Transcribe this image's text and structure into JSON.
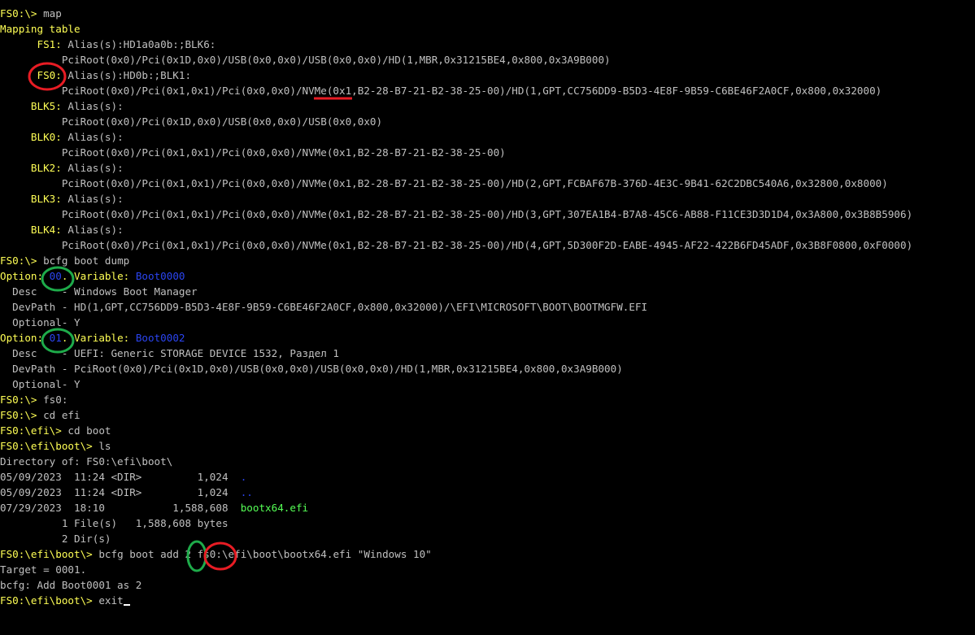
{
  "terminal": {
    "lines": [
      {
        "id": "prompt-map",
        "segments": [
          {
            "t": "FS0:\\> ",
            "c": "y"
          },
          {
            "t": "map",
            "c": "w"
          }
        ]
      },
      {
        "id": "mapping-table-heading",
        "segments": [
          {
            "t": "Mapping table",
            "c": "y"
          }
        ]
      },
      {
        "id": "map-fs1",
        "segments": [
          {
            "t": "      FS1: ",
            "c": "y"
          },
          {
            "t": "Alias(s):HD1a0a0b:;BLK6:",
            "c": "w"
          }
        ]
      },
      {
        "id": "map-fs1-path",
        "segments": [
          {
            "t": "          PciRoot(0x0)/Pci(0x1D,0x0)/USB(0x0,0x0)/USB(0x0,0x0)/HD(1,MBR,0x31215BE4,0x800,0x3A9B000)",
            "c": "w"
          }
        ]
      },
      {
        "id": "map-fs0",
        "segments": [
          {
            "t": "      FS0: ",
            "c": "y"
          },
          {
            "t": "Alias(s):HD0b:;BLK1:",
            "c": "w"
          }
        ]
      },
      {
        "id": "map-fs0-path",
        "segments": [
          {
            "t": "          PciRoot(0x0)/Pci(0x1,0x1)/Pci(0x0,0x0)/NVMe(0x1,B2-28-B7-21-B2-38-25-00)/HD(1,GPT,CC756DD9-B5D3-4E8F-9B59-C6BE46F2A0CF,0x800,0x32000)",
            "c": "w"
          }
        ]
      },
      {
        "id": "map-blk5",
        "segments": [
          {
            "t": "     BLK5: ",
            "c": "y"
          },
          {
            "t": "Alias(s):",
            "c": "w"
          }
        ]
      },
      {
        "id": "map-blk5-path",
        "segments": [
          {
            "t": "          PciRoot(0x0)/Pci(0x1D,0x0)/USB(0x0,0x0)/USB(0x0,0x0)",
            "c": "w"
          }
        ]
      },
      {
        "id": "map-blk0",
        "segments": [
          {
            "t": "     BLK0: ",
            "c": "y"
          },
          {
            "t": "Alias(s):",
            "c": "w"
          }
        ]
      },
      {
        "id": "map-blk0-path",
        "segments": [
          {
            "t": "          PciRoot(0x0)/Pci(0x1,0x1)/Pci(0x0,0x0)/NVMe(0x1,B2-28-B7-21-B2-38-25-00)",
            "c": "w"
          }
        ]
      },
      {
        "id": "map-blk2",
        "segments": [
          {
            "t": "     BLK2: ",
            "c": "y"
          },
          {
            "t": "Alias(s):",
            "c": "w"
          }
        ]
      },
      {
        "id": "map-blk2-path",
        "segments": [
          {
            "t": "          PciRoot(0x0)/Pci(0x1,0x1)/Pci(0x0,0x0)/NVMe(0x1,B2-28-B7-21-B2-38-25-00)/HD(2,GPT,FCBAF67B-376D-4E3C-9B41-62C2DBC540A6,0x32800,0x8000)",
            "c": "w"
          }
        ]
      },
      {
        "id": "map-blk3",
        "segments": [
          {
            "t": "     BLK3: ",
            "c": "y"
          },
          {
            "t": "Alias(s):",
            "c": "w"
          }
        ]
      },
      {
        "id": "map-blk3-path",
        "segments": [
          {
            "t": "          PciRoot(0x0)/Pci(0x1,0x1)/Pci(0x0,0x0)/NVMe(0x1,B2-28-B7-21-B2-38-25-00)/HD(3,GPT,307EA1B4-B7A8-45C6-AB88-F11CE3D3D1D4,0x3A800,0x3B8B5906)",
            "c": "w"
          }
        ]
      },
      {
        "id": "map-blk4",
        "segments": [
          {
            "t": "     BLK4: ",
            "c": "y"
          },
          {
            "t": "Alias(s):",
            "c": "w"
          }
        ]
      },
      {
        "id": "map-blk4-path",
        "segments": [
          {
            "t": "          PciRoot(0x0)/Pci(0x1,0x1)/Pci(0x0,0x0)/NVMe(0x1,B2-28-B7-21-B2-38-25-00)/HD(4,GPT,5D300F2D-EABE-4945-AF22-422B6FD45ADF,0x3B8F0800,0xF0000)",
            "c": "w"
          }
        ]
      },
      {
        "id": "prompt-bcfg-dump",
        "segments": [
          {
            "t": "FS0:\\> ",
            "c": "y"
          },
          {
            "t": "bcfg boot dump",
            "c": "w"
          }
        ]
      },
      {
        "id": "option-00",
        "segments": [
          {
            "t": "Option: ",
            "c": "y"
          },
          {
            "t": "00",
            "c": "b"
          },
          {
            "t": ". Variable: ",
            "c": "y"
          },
          {
            "t": "Boot0000",
            "c": "b"
          }
        ]
      },
      {
        "id": "option-00-desc",
        "segments": [
          {
            "t": "  Desc    - Windows Boot Manager",
            "c": "w"
          }
        ]
      },
      {
        "id": "option-00-devpath",
        "segments": [
          {
            "t": "  DevPath - HD(1,GPT,CC756DD9-B5D3-4E8F-9B59-C6BE46F2A0CF,0x800,0x32000)/\\EFI\\MICROSOFT\\BOOT\\BOOTMGFW.EFI",
            "c": "w"
          }
        ]
      },
      {
        "id": "option-00-optional",
        "segments": [
          {
            "t": "  Optional- Y",
            "c": "w"
          }
        ]
      },
      {
        "id": "option-01",
        "segments": [
          {
            "t": "Option: ",
            "c": "y"
          },
          {
            "t": "01",
            "c": "b"
          },
          {
            "t": ". Variable: ",
            "c": "y"
          },
          {
            "t": "Boot0002",
            "c": "b"
          }
        ]
      },
      {
        "id": "option-01-desc",
        "segments": [
          {
            "t": "  Desc    - UEFI: Generic STORAGE DEVICE 1532, Раздел 1",
            "c": "w"
          }
        ]
      },
      {
        "id": "option-01-devpath",
        "segments": [
          {
            "t": "  DevPath - PciRoot(0x0)/Pci(0x1D,0x0)/USB(0x0,0x0)/USB(0x0,0x0)/HD(1,MBR,0x31215BE4,0x800,0x3A9B000)",
            "c": "w"
          }
        ]
      },
      {
        "id": "option-01-optional",
        "segments": [
          {
            "t": "  Optional- Y",
            "c": "w"
          }
        ]
      },
      {
        "id": "prompt-fs0",
        "segments": [
          {
            "t": "FS0:\\> ",
            "c": "y"
          },
          {
            "t": "fs0:",
            "c": "w"
          }
        ]
      },
      {
        "id": "prompt-cd-efi",
        "segments": [
          {
            "t": "FS0:\\> ",
            "c": "y"
          },
          {
            "t": "cd efi",
            "c": "w"
          }
        ]
      },
      {
        "id": "prompt-cd-boot",
        "segments": [
          {
            "t": "FS0:\\efi\\> ",
            "c": "y"
          },
          {
            "t": "cd boot",
            "c": "w"
          }
        ]
      },
      {
        "id": "prompt-ls",
        "segments": [
          {
            "t": "FS0:\\efi\\boot\\> ",
            "c": "y"
          },
          {
            "t": "ls",
            "c": "w"
          }
        ]
      },
      {
        "id": "dir-header",
        "segments": [
          {
            "t": "Directory of: FS0:\\efi\\boot\\",
            "c": "w"
          }
        ]
      },
      {
        "id": "dir-row-dot",
        "segments": [
          {
            "t": "05/09/2023  11:24 <DIR>         1,024  ",
            "c": "w"
          },
          {
            "t": ".",
            "c": "b"
          }
        ]
      },
      {
        "id": "dir-row-dotdot",
        "segments": [
          {
            "t": "05/09/2023  11:24 <DIR>         1,024  ",
            "c": "w"
          },
          {
            "t": "..",
            "c": "b"
          }
        ]
      },
      {
        "id": "dir-row-bootx64",
        "segments": [
          {
            "t": "07/29/2023  18:10           1,588,608  ",
            "c": "w"
          },
          {
            "t": "bootx64.efi",
            "c": "g"
          }
        ]
      },
      {
        "id": "dir-files",
        "segments": [
          {
            "t": "          1 File(s)   1,588,608 bytes",
            "c": "w"
          }
        ]
      },
      {
        "id": "dir-dirs",
        "segments": [
          {
            "t": "          2 Dir(s)",
            "c": "w"
          }
        ]
      },
      {
        "id": "prompt-bcfg-add",
        "segments": [
          {
            "t": "FS0:\\efi\\boot\\> ",
            "c": "y"
          },
          {
            "t": "bcfg boot add 2 fs0:\\efi\\boot\\bootx64.efi \"Windows 10\"",
            "c": "w"
          }
        ]
      },
      {
        "id": "target-output",
        "segments": [
          {
            "t": "Target = 0001.",
            "c": "w"
          }
        ]
      },
      {
        "id": "bcfg-add-output",
        "segments": [
          {
            "t": "bcfg: Add Boot0001 as 2",
            "c": "w"
          }
        ]
      },
      {
        "id": "prompt-exit",
        "segments": [
          {
            "t": "FS0:\\efi\\boot\\> ",
            "c": "y"
          },
          {
            "t": "exit",
            "c": "w"
          }
        ],
        "cursor": true
      }
    ]
  },
  "annotations": {
    "red": "#e81c24",
    "green": "#1eab4a"
  }
}
